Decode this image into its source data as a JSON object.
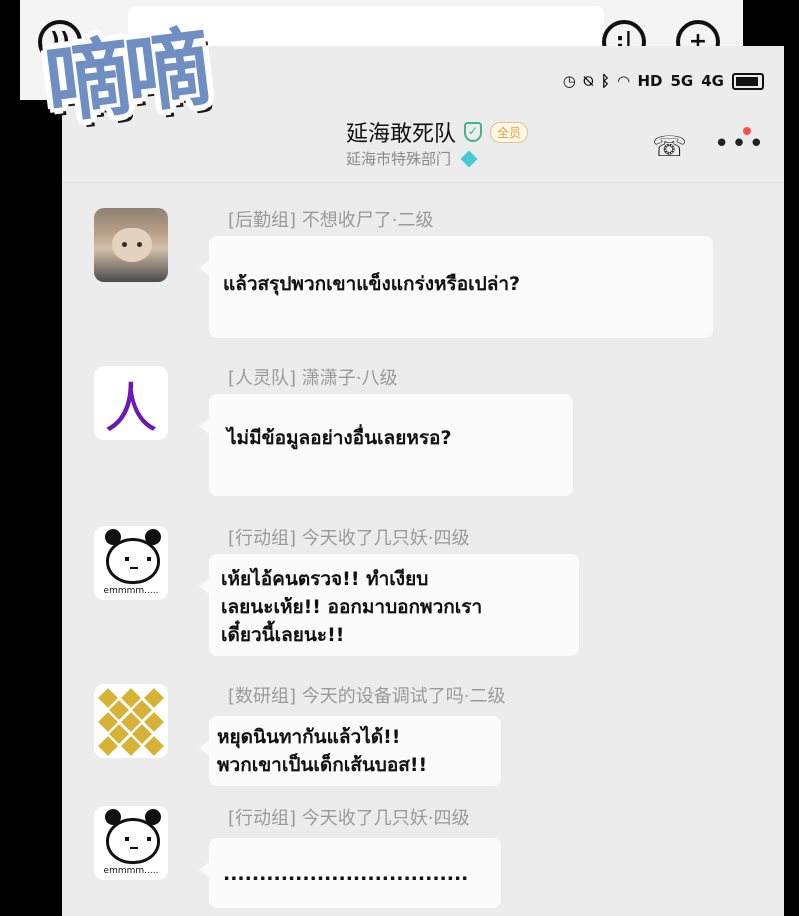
{
  "sound_effect": "嘀嘀",
  "background_window": {
    "left_icon": "voice-wave-icon",
    "right_icons": [
      "emoji-icon",
      "plus-icon"
    ]
  },
  "status_bar": {
    "icons": [
      "alarm-icon",
      "mute-icon",
      "bluetooth-icon",
      "wifi-icon",
      "hd-icon",
      "5g-signal-icon",
      "4g-signal-icon",
      "battery-icon"
    ],
    "hd_label": "HD",
    "five_g_label": "5G",
    "four_g_label": "4G"
  },
  "chat_header": {
    "title": "延海敢死队",
    "badge": "全员",
    "subtitle": "延海市特殊部门",
    "icons": [
      "verified-icon",
      "diamond-icon",
      "phone-video-icon",
      "more-icon"
    ],
    "colors": {
      "verified": "#44b58a",
      "badge_text": "#e0a040",
      "diamond": "#47c9d8",
      "notification_dot": "#ff4d4f"
    }
  },
  "messages": [
    {
      "meta": "[后勤组]  不想收尸了·二级",
      "text": "แล้วสรุปพวกเขาแข็งแกร่งหรือเปล่า?"
    },
    {
      "meta": "[人灵队]  潇潇子·八级",
      "avatar_text": "人",
      "text": "ไม่มีข้อมูลอย่างอื่นเลยหรอ?"
    },
    {
      "meta": "[行动组]  今天收了几只妖·四级",
      "avatar_caption": "emmmm.....",
      "text": "เห้ยไอ้คนตรวจ!! ทำเงียบ\nเลยนะเห้ย!! ออกมาบอกพวกเรา\nเดี๋ยวนี้เลยนะ!!"
    },
    {
      "meta": "[数研组]  今天的设备调试了吗·二级",
      "text": "หยุดนินทากันแล้วได้!!\nพวกเขาเป็นเด็กเส้นบอส!!"
    },
    {
      "meta": "[行动组]  今天收了几只妖·四级",
      "avatar_caption": "emmmm.....",
      "text": ".................................."
    }
  ]
}
